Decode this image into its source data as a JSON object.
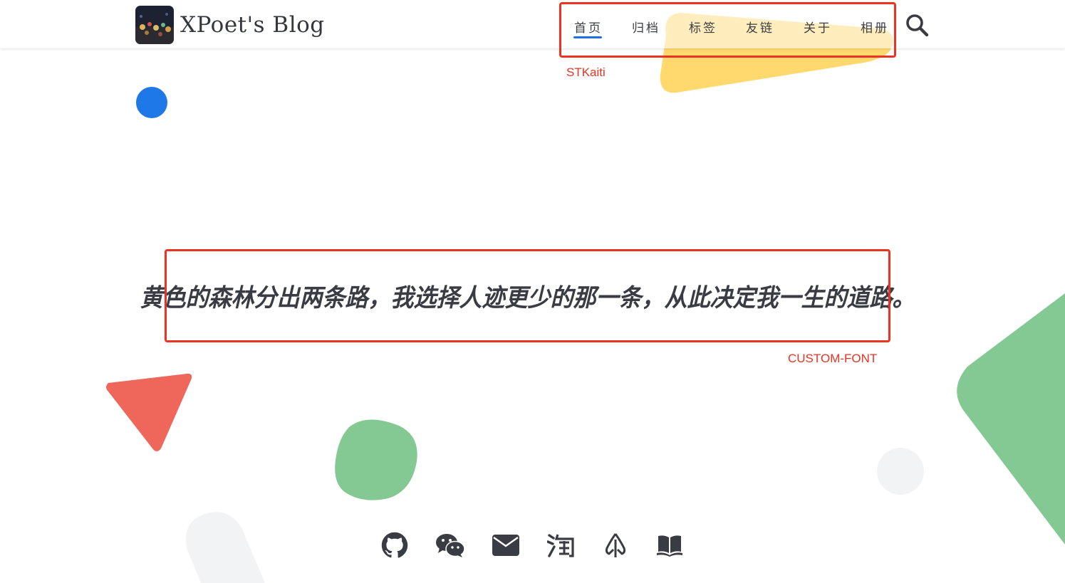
{
  "header": {
    "site_title": "XPoet's Blog",
    "logo_alt": "blog-avatar"
  },
  "nav": {
    "items": [
      {
        "label": "首页",
        "active": true
      },
      {
        "label": "归档",
        "active": false
      },
      {
        "label": "标签",
        "active": false
      },
      {
        "label": "友链",
        "active": false
      },
      {
        "label": "关于",
        "active": false
      },
      {
        "label": "相册",
        "active": false
      }
    ],
    "search_icon": "search-icon"
  },
  "annotations": {
    "nav_font_label": "STKaiti",
    "motto_font_label": "CUSTOM-FONT"
  },
  "hero": {
    "motto": "黄色的森林分出两条路，我选择人迹更少的那一条，从此决定我一生的道路。"
  },
  "social_links": [
    {
      "name": "github",
      "icon": "github-icon"
    },
    {
      "name": "wechat",
      "icon": "wechat-icon"
    },
    {
      "name": "email",
      "icon": "envelope-icon"
    },
    {
      "name": "taobao",
      "icon": "taobao-icon"
    },
    {
      "name": "yuque",
      "icon": "leaf-icon"
    },
    {
      "name": "docs",
      "icon": "book-open-icon"
    }
  ],
  "colors": {
    "accent": "#1f6fe0",
    "annotation": "#ea3323",
    "text": "#3a3c44",
    "yellow_shape": "#ffd666",
    "green_shape": "#84c994",
    "red_shape": "#ef665a",
    "blue_dot": "#1e78e8",
    "grey_shape": "#f2f3f5"
  }
}
